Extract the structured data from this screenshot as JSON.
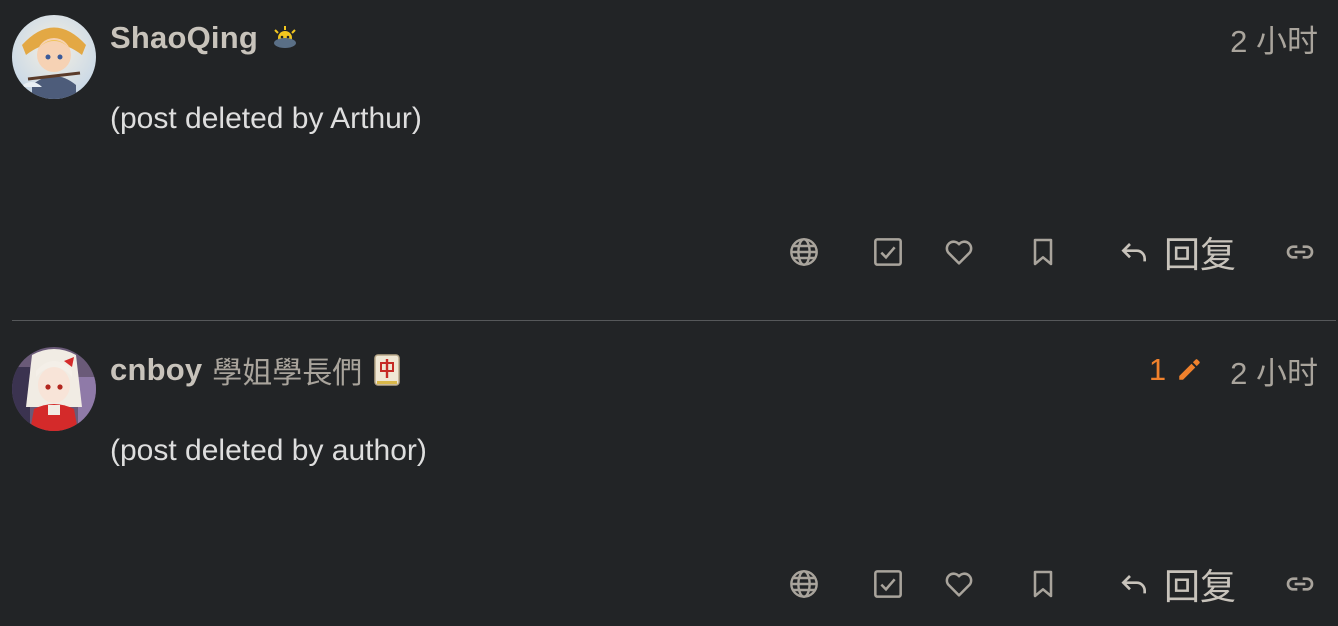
{
  "posts": [
    {
      "username": "ShaoQing",
      "user_title": "",
      "flair_icon": "sun-cloud-flair-icon",
      "date": "2 小时",
      "body": "(post deleted by Arthur)",
      "edit_count": "",
      "actions": {
        "translate_icon": "globe-icon",
        "solution_icon": "check-square-icon",
        "like_icon": "heart-icon",
        "bookmark_icon": "bookmark-icon",
        "reply_label": "回复",
        "share_icon": "link-icon"
      }
    },
    {
      "username": "cnboy",
      "user_title": "學姐學長們",
      "flair_icon": "mahjong-red-dragon-icon",
      "date": "2 小时",
      "body": "(post deleted by author)",
      "edit_count": "1",
      "actions": {
        "translate_icon": "globe-icon",
        "solution_icon": "check-square-icon",
        "like_icon": "heart-icon",
        "bookmark_icon": "bookmark-icon",
        "reply_label": "回复",
        "share_icon": "link-icon"
      }
    }
  ],
  "colors": {
    "background": "#222426",
    "text": "#dedede",
    "muted": "#a9a49c",
    "accent_edit": "#f0812c",
    "divider": "#56585a"
  }
}
